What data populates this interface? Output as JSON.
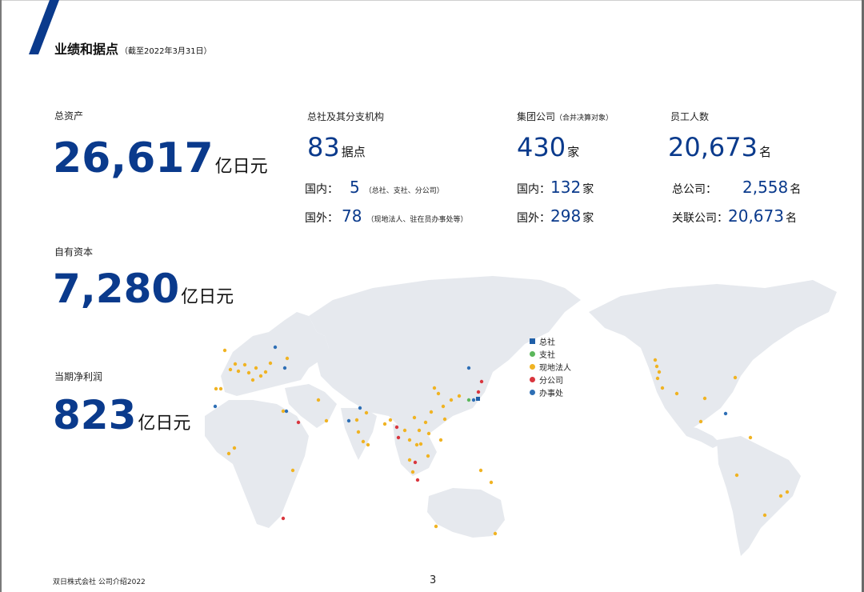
{
  "header": {
    "title": "业绩和据点",
    "note": "（截至2022年3月31日）"
  },
  "total_assets": {
    "label": "总资产",
    "value": "26,617",
    "unit": "亿日元"
  },
  "equity": {
    "label": "自有资本",
    "value": "7,280",
    "unit": "亿日元"
  },
  "net_income": {
    "label": "当期净利润",
    "value": "823",
    "unit": "亿日元"
  },
  "offices": {
    "label": "总社及其分支机构",
    "value": "83",
    "unit": "据点",
    "domestic_label": "国内：",
    "domestic_value": "5",
    "domestic_note": "（总社、支社、分公司）",
    "overseas_label": "国外：",
    "overseas_value": "78",
    "overseas_note": "（现地法人、驻在员办事处等）"
  },
  "group": {
    "label": "集团公司",
    "label_note": "（合并决算对象）",
    "value": "430",
    "unit": "家",
    "domestic_label": "国内：",
    "domestic_value": "132",
    "domestic_unit": "家",
    "overseas_label": "国外：",
    "overseas_value": "298",
    "overseas_unit": "家"
  },
  "employees": {
    "label": "员工人数",
    "value": "20,673",
    "unit": "名",
    "parent_label": "总公司：",
    "parent_value": "2,558",
    "parent_unit": "名",
    "affiliate_label": "关联公司：",
    "affiliate_value": "20,673",
    "affiliate_unit": "名"
  },
  "legend": [
    {
      "label": "总社",
      "color": "#1f5fa8",
      "shape": "square"
    },
    {
      "label": "支社",
      "color": "#5bb75b",
      "shape": "circle"
    },
    {
      "label": "现地法人",
      "color": "#f0b323",
      "shape": "circle"
    },
    {
      "label": "分公司",
      "color": "#d9363e",
      "shape": "circle"
    },
    {
      "label": "办事处",
      "color": "#2e6fb5",
      "shape": "circle"
    }
  ],
  "footer": {
    "company": "双日株式会社    公司介绍2022",
    "page": "3"
  }
}
